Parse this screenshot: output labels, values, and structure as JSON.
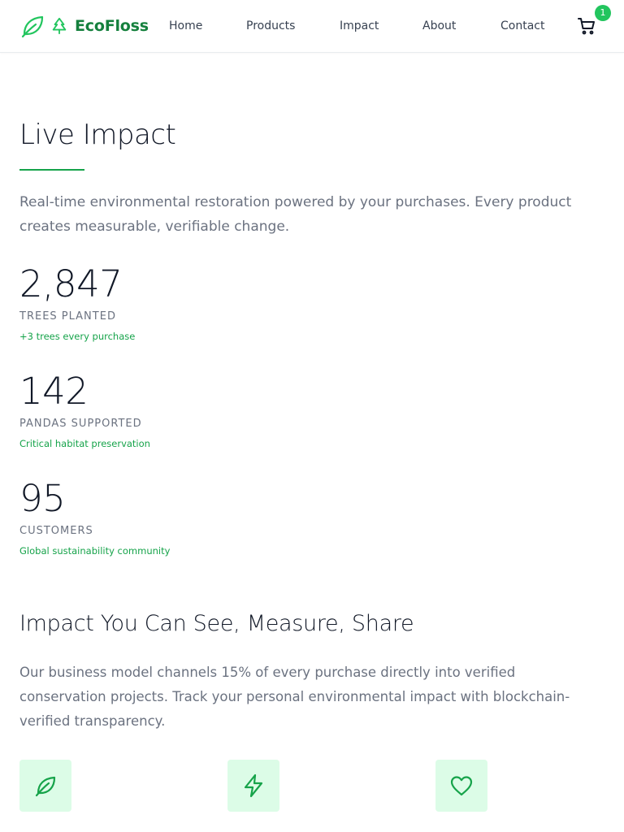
{
  "header": {
    "brand": "EcoFloss",
    "nav": [
      "Home",
      "Products",
      "Impact",
      "About",
      "Contact"
    ],
    "cart_count": "1"
  },
  "live_impact": {
    "title": "Live Impact",
    "description": "Real-time environmental restoration powered by your purchases. Every product creates measurable, verifiable change.",
    "stats": [
      {
        "value": "2,847",
        "label": "TREES PLANTED",
        "note": "+3 trees every purchase"
      },
      {
        "value": "142",
        "label": "PANDAS SUPPORTED",
        "note": "Critical habitat preservation"
      },
      {
        "value": "95",
        "label": "CUSTOMERS",
        "note": "Global sustainability community"
      }
    ]
  },
  "impact_share": {
    "title": "Impact You Can See, Measure, Share",
    "description": "Our business model channels 15% of every purchase directly into verified conservation projects. Track your personal environmental impact with blockchain-verified transparency."
  },
  "features": [
    {
      "icon": "leaf-icon"
    },
    {
      "icon": "lightning-icon"
    },
    {
      "icon": "heart-icon"
    }
  ],
  "colors": {
    "accent": "#16a34a",
    "brand": "#15803d",
    "badge": "#22c55e",
    "tile_bg": "#dcfce7"
  }
}
